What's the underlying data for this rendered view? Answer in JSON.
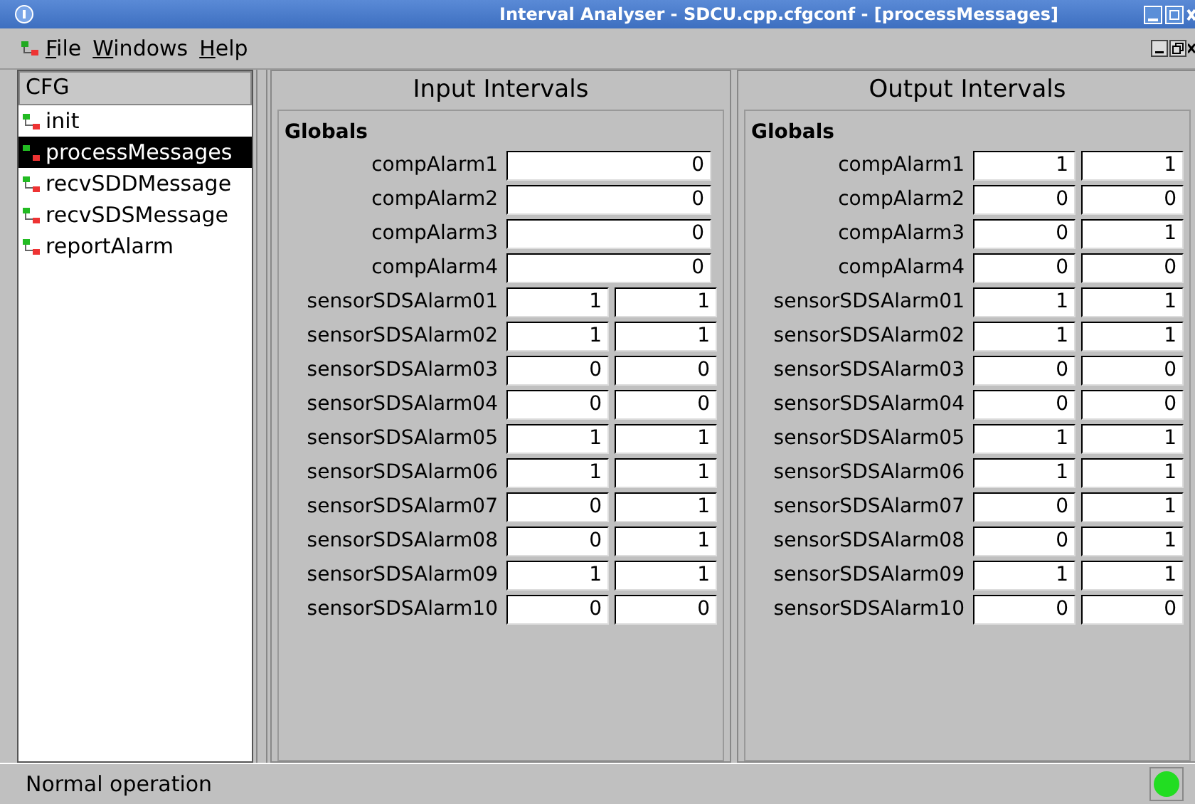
{
  "window": {
    "title": "Interval Analyser - SDCU.cpp.cfgconf - [processMessages]"
  },
  "menu": [
    "File",
    "Windows",
    "Help"
  ],
  "sidebar": {
    "header": "CFG",
    "items": [
      {
        "label": "init",
        "selected": false
      },
      {
        "label": "processMessages",
        "selected": true
      },
      {
        "label": "recvSDDMessage",
        "selected": false
      },
      {
        "label": "recvSDSMessage",
        "selected": false
      },
      {
        "label": "reportAlarm",
        "selected": false
      }
    ]
  },
  "panels": [
    {
      "title": "Input Intervals",
      "section": "Globals",
      "rows": [
        {
          "name": "compAlarm1",
          "values": [
            "0"
          ]
        },
        {
          "name": "compAlarm2",
          "values": [
            "0"
          ]
        },
        {
          "name": "compAlarm3",
          "values": [
            "0"
          ]
        },
        {
          "name": "compAlarm4",
          "values": [
            "0"
          ]
        },
        {
          "name": "sensorSDSAlarm01",
          "values": [
            "1",
            "1"
          ]
        },
        {
          "name": "sensorSDSAlarm02",
          "values": [
            "1",
            "1"
          ]
        },
        {
          "name": "sensorSDSAlarm03",
          "values": [
            "0",
            "0"
          ]
        },
        {
          "name": "sensorSDSAlarm04",
          "values": [
            "0",
            "0"
          ]
        },
        {
          "name": "sensorSDSAlarm05",
          "values": [
            "1",
            "1"
          ]
        },
        {
          "name": "sensorSDSAlarm06",
          "values": [
            "1",
            "1"
          ]
        },
        {
          "name": "sensorSDSAlarm07",
          "values": [
            "0",
            "1"
          ]
        },
        {
          "name": "sensorSDSAlarm08",
          "values": [
            "0",
            "1"
          ]
        },
        {
          "name": "sensorSDSAlarm09",
          "values": [
            "1",
            "1"
          ]
        },
        {
          "name": "sensorSDSAlarm10",
          "values": [
            "0",
            "0"
          ]
        }
      ]
    },
    {
      "title": "Output Intervals",
      "section": "Globals",
      "rows": [
        {
          "name": "compAlarm1",
          "values": [
            "1",
            "1"
          ]
        },
        {
          "name": "compAlarm2",
          "values": [
            "0",
            "0"
          ]
        },
        {
          "name": "compAlarm3",
          "values": [
            "0",
            "1"
          ]
        },
        {
          "name": "compAlarm4",
          "values": [
            "0",
            "0"
          ]
        },
        {
          "name": "sensorSDSAlarm01",
          "values": [
            "1",
            "1"
          ]
        },
        {
          "name": "sensorSDSAlarm02",
          "values": [
            "1",
            "1"
          ]
        },
        {
          "name": "sensorSDSAlarm03",
          "values": [
            "0",
            "0"
          ]
        },
        {
          "name": "sensorSDSAlarm04",
          "values": [
            "0",
            "0"
          ]
        },
        {
          "name": "sensorSDSAlarm05",
          "values": [
            "1",
            "1"
          ]
        },
        {
          "name": "sensorSDSAlarm06",
          "values": [
            "1",
            "1"
          ]
        },
        {
          "name": "sensorSDSAlarm07",
          "values": [
            "0",
            "1"
          ]
        },
        {
          "name": "sensorSDSAlarm08",
          "values": [
            "0",
            "1"
          ]
        },
        {
          "name": "sensorSDSAlarm09",
          "values": [
            "1",
            "1"
          ]
        },
        {
          "name": "sensorSDSAlarm10",
          "values": [
            "0",
            "0"
          ]
        }
      ]
    }
  ],
  "status_bar": {
    "text": "Normal operation",
    "indicator_on": true
  }
}
